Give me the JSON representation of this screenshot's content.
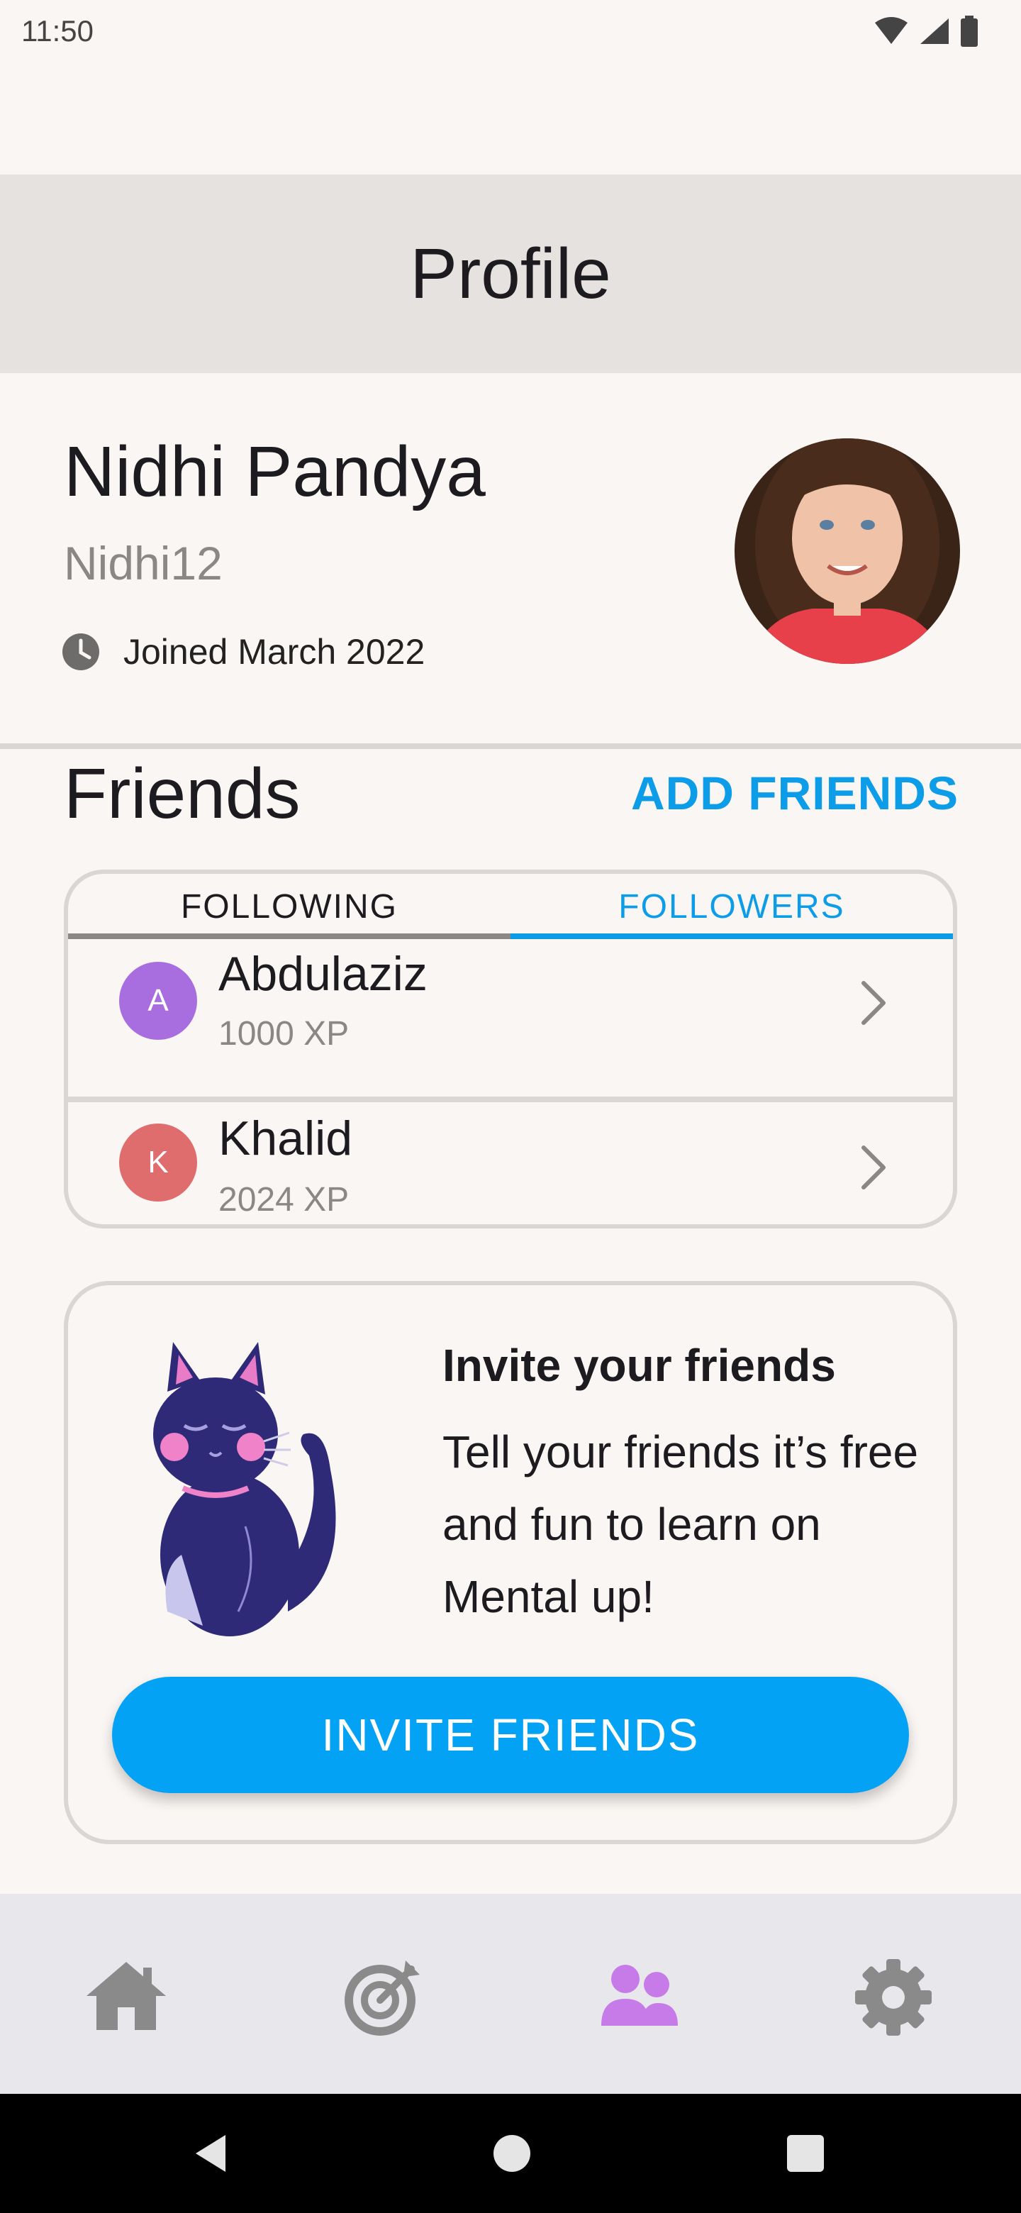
{
  "status_bar": {
    "time": "11:50"
  },
  "app_bar": {
    "title": "Profile"
  },
  "profile": {
    "name": "Nidhi Pandya",
    "username": "Nidhi12",
    "joined": "Joined March 2022"
  },
  "friends": {
    "title": "Friends",
    "add_label": "ADD FRIENDS",
    "tabs": [
      {
        "label": "FOLLOWING",
        "active": false
      },
      {
        "label": "FOLLOWERS",
        "active": true
      }
    ],
    "list": [
      {
        "initial": "A",
        "name": "Abdulaziz",
        "xp": "1000 XP",
        "color": "#a86ee0"
      },
      {
        "initial": "K",
        "name": "Khalid",
        "xp": "2024 XP",
        "color": "#e06d6d"
      }
    ]
  },
  "invite": {
    "title": "Invite your friends",
    "body": "Tell your friends it’s free and fun to learn on Mental up!",
    "button_label": "INVITE FRIENDS"
  },
  "bottom_nav": [
    {
      "icon": "home-icon",
      "active": false
    },
    {
      "icon": "target-icon",
      "active": false
    },
    {
      "icon": "friends-icon",
      "active": true
    },
    {
      "icon": "gear-icon",
      "active": false
    }
  ],
  "colors": {
    "accent": "#0d9de8",
    "button": "#03a2f5",
    "nav_active": "#c77be8",
    "nav_inactive": "#8a8a8a",
    "background": "#faf6f3"
  }
}
